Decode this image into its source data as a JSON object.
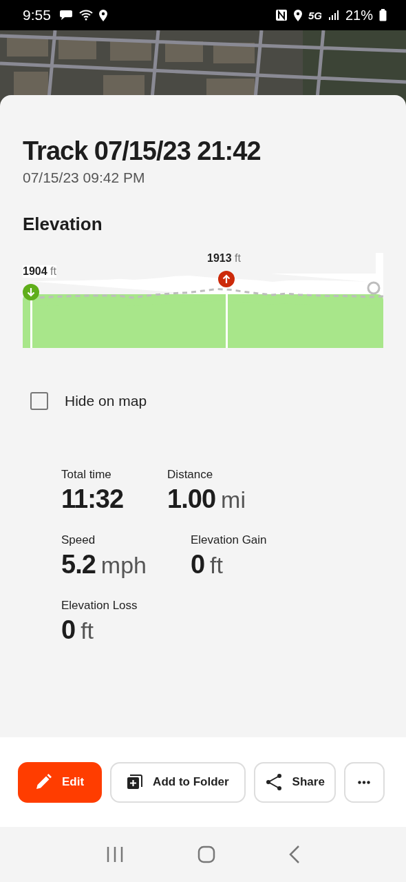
{
  "status_bar": {
    "time": "9:55",
    "network": "5G",
    "battery": "21%"
  },
  "map": {
    "kind": "picture"
  },
  "track": {
    "title": "Track 07/15/23 21:42",
    "date": "07/15/23 09:42 PM"
  },
  "elevation": {
    "heading": "Elevation",
    "start_label": "**1904** ft",
    "peak_label": "**1913** ft"
  },
  "hide_on_map": {
    "label": "Hide on map",
    "checked": false
  },
  "stats": [
    [
      {
        "label": "Total time",
        "value": "11:32"
      },
      {
        "label": "Distance",
        "value": "1.00",
        "unit": "mi"
      }
    ],
    [
      {
        "label": "Speed",
        "value": "5.2",
        "unit": "mph"
      },
      {
        "label": "Elevation Gain",
        "value": "0",
        "unit": "ft"
      }
    ],
    [
      {
        "label": "Elevation Loss",
        "value": "0",
        "unit": "ft"
      }
    ]
  ],
  "actions": [
    {
      "kind": "edit",
      "label": "Edit"
    },
    {
      "kind": "folder",
      "label": "Add to Folder"
    },
    {
      "kind": "share",
      "label": "Share"
    },
    {
      "kind": "more"
    }
  ]
}
